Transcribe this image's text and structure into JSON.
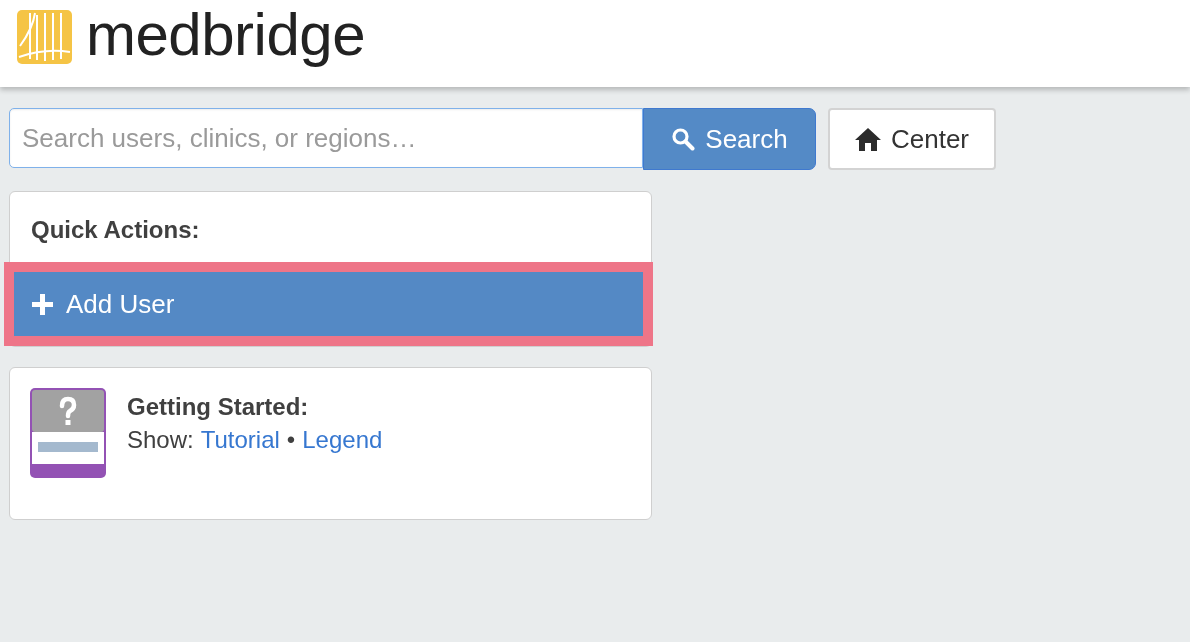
{
  "header": {
    "logo_text": "medbridge"
  },
  "search": {
    "placeholder": "Search users, clinics, or regions…",
    "button": "Search"
  },
  "center_button": {
    "label": "Center"
  },
  "quick_actions": {
    "title": "Quick Actions:",
    "actions": [
      {
        "label": "Add User",
        "highlighted": true
      }
    ]
  },
  "getting_started": {
    "title": "Getting Started:",
    "prefix": "Show:",
    "links": [
      "Tutorial",
      "Legend"
    ],
    "separator": "•"
  }
}
